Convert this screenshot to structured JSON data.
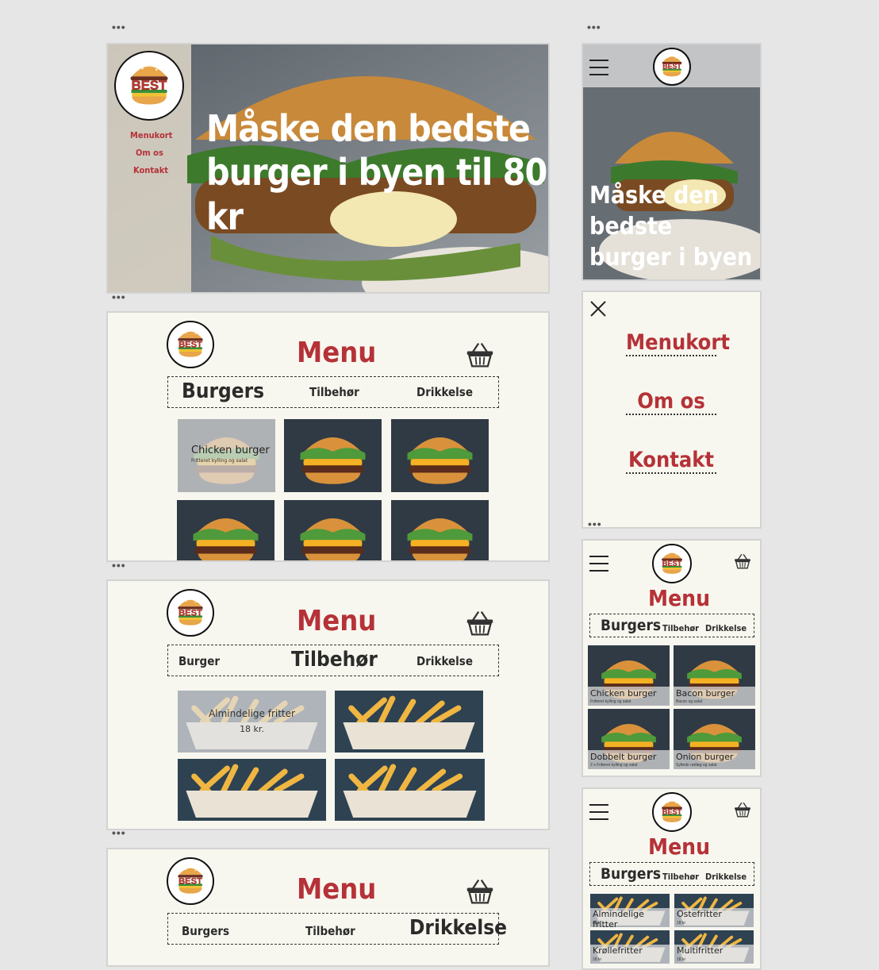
{
  "logo": {
    "text": "BEST"
  },
  "hero_desktop": {
    "nav": [
      "Menukort",
      "Om os",
      "Kontakt"
    ],
    "headline_1": "Måske den bedste",
    "headline_2": "burger i byen til 80 kr"
  },
  "hero_mobile": {
    "line1": "Måske den",
    "line2": "bedste",
    "line3": "burger i byen"
  },
  "menu_title": "Menu",
  "tabs_burgers": {
    "a": "Burgers",
    "b": "Tilbehør",
    "c": "Drikkelse"
  },
  "tabs_tilbehor": {
    "a": "Burger",
    "b": "Tilbehør",
    "c": "Drikkelse"
  },
  "tabs_drinks": {
    "a": "Burgers",
    "b": "Tilbehør",
    "c": "Drikkelse"
  },
  "burger_desktop": {
    "name": "Chicken burger",
    "desc": "Fritteret kylling og salat"
  },
  "fries_desktop": {
    "name": "Almindelige fritter",
    "price": "18 kr."
  },
  "mobile_nav": {
    "items": [
      "Menukort",
      "Om os",
      "Kontakt"
    ]
  },
  "mobile_burgers": [
    {
      "name": "Chicken burger",
      "desc": "Fritteret kylling og salat"
    },
    {
      "name": "Bacon burger",
      "desc": "Bacon og salat"
    },
    {
      "name": "Dobbelt burger",
      "desc": "2 x Fritteret kylling og salat"
    },
    {
      "name": "Onion burger",
      "desc": "Syltede rødløg og salat"
    }
  ],
  "mobile_fries": [
    {
      "name": "Almindelige fritter",
      "price": "18 kr"
    },
    {
      "name": "Ostefritter",
      "price": "18 kr"
    },
    {
      "name": "Krøllefritter",
      "price": "18 kr"
    },
    {
      "name": "Multifritter",
      "price": "18 kr"
    }
  ],
  "colors": {
    "accent": "#b53238",
    "panel": "#f8f7ef",
    "canvas": "#e6e6e6"
  }
}
